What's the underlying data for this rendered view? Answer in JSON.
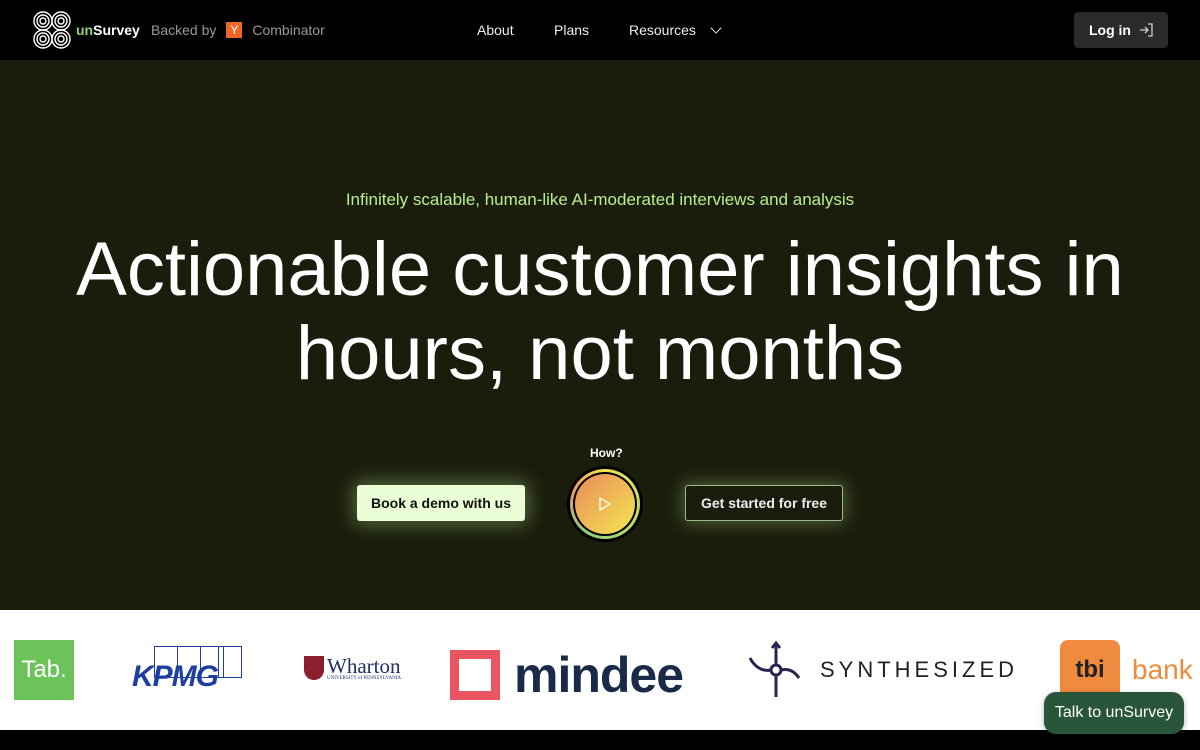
{
  "nav": {
    "brand_prefix": "un",
    "brand_suffix": "Survey",
    "backed_by": "Backed by",
    "yc_letter": "Y",
    "combinator": "Combinator",
    "links": [
      {
        "label": "About"
      },
      {
        "label": "Plans"
      },
      {
        "label": "Resources"
      }
    ],
    "login": "Log in",
    "login_icon": "log-in-arrow-icon"
  },
  "hero": {
    "tagline": "Infinitely scalable, human-like AI-moderated interviews and analysis",
    "title_line1": "Actionable customer insights in",
    "title_line2": "hours, not months",
    "how": "How?",
    "demo_button": "Book a demo with us",
    "free_button": "Get started for free",
    "play_icon": "play-icon"
  },
  "logos": {
    "tab": "Tab.",
    "kpmg": "KPMG",
    "wharton": "Wharton",
    "wharton_sub": "UNIVERSITY of PENNSYLVANIA",
    "mindee": "mindee",
    "synthesized": "SYNTHESIZED",
    "tbi": "tbi",
    "bank": "bank"
  },
  "chat": {
    "label": "Talk to unSurvey"
  },
  "colors": {
    "accent": "#b8ef8e",
    "hero_bg": "#1a1d0c",
    "chat_bg": "#29563b",
    "yc": "#f26625"
  }
}
